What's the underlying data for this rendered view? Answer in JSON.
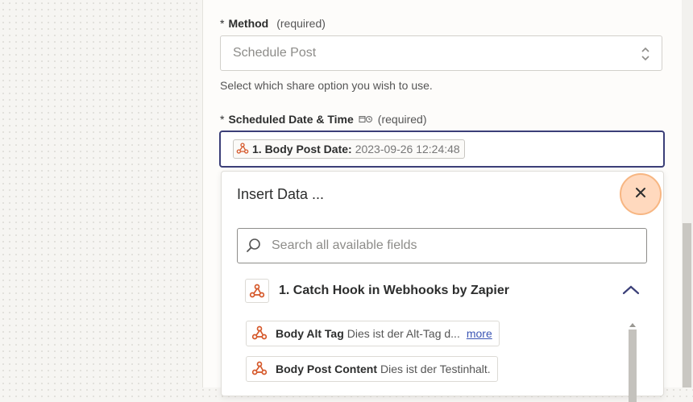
{
  "method": {
    "label": "Method",
    "required": "(required)",
    "star": "*",
    "selected_value": "Schedule Post",
    "help": "Select which share option you wish to use."
  },
  "scheduled": {
    "label": "Scheduled Date & Time",
    "required": "(required)",
    "star": "*",
    "pill": {
      "label": "1. Body Post Date:",
      "value": "2023-09-26 12:24:48"
    }
  },
  "insert_data": {
    "title": "Insert Data ...",
    "search_placeholder": "Search all available fields",
    "group_title": "1. Catch Hook in Webhooks by Zapier",
    "fields": [
      {
        "label": "Body Alt Tag",
        "value": "Dies ist der Alt-Tag d...",
        "more": "more"
      },
      {
        "label": "Body Post Content",
        "value": "Dies ist der Testinhalt."
      }
    ]
  },
  "colors": {
    "webhook_icon": "#d5582a",
    "focus_border": "#3b3f78",
    "close_highlight": "#f7b682",
    "link": "#3b55b5"
  },
  "icons": {
    "webhook": "webhook-icon",
    "close": "close-icon",
    "search": "search-icon",
    "chevron": "chevron-up-icon",
    "select_arrows": "select-arrows-icon",
    "calendar_clock": "calendar-clock-icon"
  }
}
